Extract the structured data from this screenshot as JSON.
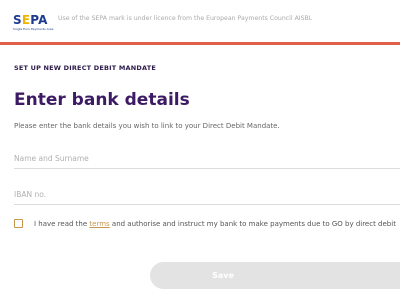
{
  "header": {
    "logo_text": "SEPA",
    "logo_text_pre": "S",
    "logo_text_e": "E",
    "logo_text_post": "PA",
    "logo_subtext": "Single Euro Payments Area",
    "notice": "Use of the SEPA mark is under licence from the European Payments Council AISBL"
  },
  "colors": {
    "accent_bar": "#e0604a",
    "title": "#3d1b64",
    "logo_blue": "#1d3b8f",
    "logo_yellow": "#f0b400",
    "link": "#c8954f",
    "button_disabled": "#e3e3e3"
  },
  "form": {
    "step_label": "SET UP NEW DIRECT DEBIT MANDATE",
    "title": "Enter bank details",
    "instructions": "Please enter the bank details you wish to link to your Direct Debit Mandate.",
    "name_placeholder": "Name and Surname",
    "name_value": "",
    "iban_placeholder": "IBAN no.",
    "iban_value": "",
    "consent_prefix": "I have read the ",
    "consent_link": "terms",
    "consent_suffix": " and authorise and instruct my bank to make payments due to GO by direct debit",
    "consent_checked": false,
    "save_label": "Save"
  }
}
